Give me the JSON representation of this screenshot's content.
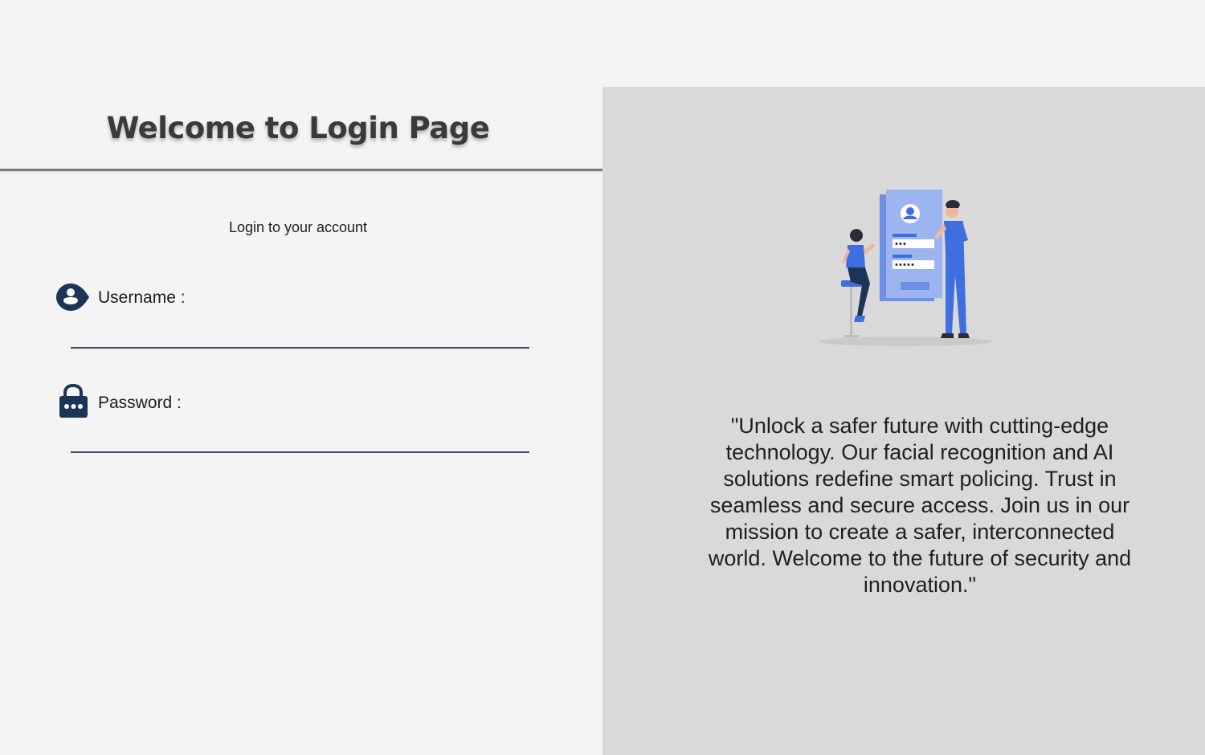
{
  "login": {
    "title": "Welcome to Login Page",
    "subtitle": "Login to your account",
    "username": {
      "label": "Username :",
      "value": ""
    },
    "password": {
      "label": "Password :",
      "value": ""
    }
  },
  "promo": {
    "quote": "\"Unlock a safer future with cutting-edge technology. Our facial recognition and AI solutions redefine smart policing. Trust in seamless and secure access. Join us in our mission to create a safer, interconnected world. Welcome to the future of security and innovation.\""
  },
  "icons": {
    "username": "user-badge-icon",
    "password": "lock-icon",
    "illustration": "login-illustration"
  },
  "colors": {
    "icon": "#1c3557",
    "illustration_blue": "#3f6ee0",
    "panel_right": "#d9d9d9",
    "background": "#f4f4f4"
  }
}
